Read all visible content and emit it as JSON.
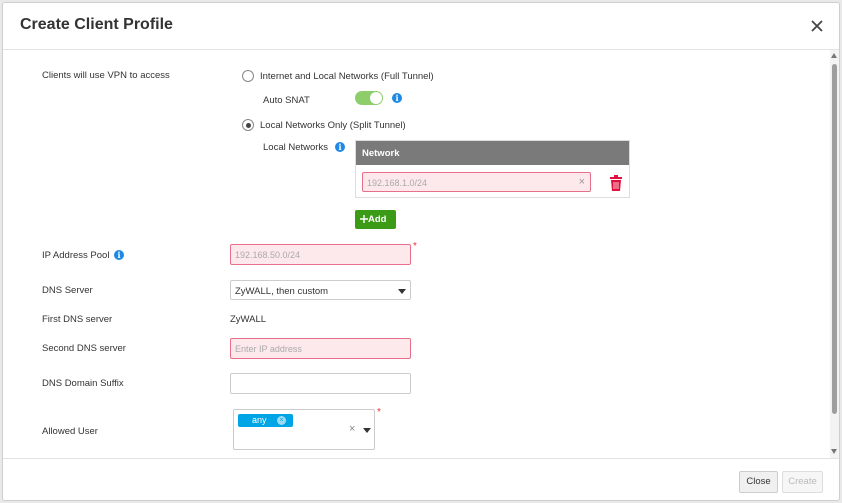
{
  "dialog": {
    "title": "Create Client Profile"
  },
  "form": {
    "vpn_access_label": "Clients will use VPN to access",
    "full_tunnel_label": "Internet and Local Networks (Full Tunnel)",
    "auto_snat_label": "Auto SNAT",
    "auto_snat_on": true,
    "split_tunnel_label": "Local Networks Only (Split Tunnel)",
    "selected_mode": "split",
    "local_networks_label": "Local Networks",
    "network_table": {
      "header": "Network",
      "rows": [
        {
          "placeholder": "192.168.1.0/24"
        }
      ]
    },
    "add_label": "Add",
    "ip_pool_label": "IP Address Pool",
    "ip_pool_placeholder": "192.168.50.0/24",
    "dns_server_label": "DNS Server",
    "dns_server_value": "ZyWALL, then custom",
    "first_dns_label": "First DNS server",
    "first_dns_value": "ZyWALL",
    "second_dns_label": "Second DNS server",
    "second_dns_placeholder": "Enter IP address",
    "dns_suffix_label": "DNS Domain Suffix",
    "dns_suffix_value": "",
    "allowed_user_label": "Allowed User",
    "allowed_user_tags": [
      "any"
    ]
  },
  "footer": {
    "close_label": "Close",
    "create_label": "Create"
  },
  "colors": {
    "accent_green": "#3b9b16",
    "toggle_green": "#8dce6b",
    "info_blue": "#1e88e5",
    "tag_blue": "#00a5e6",
    "error_pink": "#fde8ec",
    "delete_red": "#e0113c"
  }
}
